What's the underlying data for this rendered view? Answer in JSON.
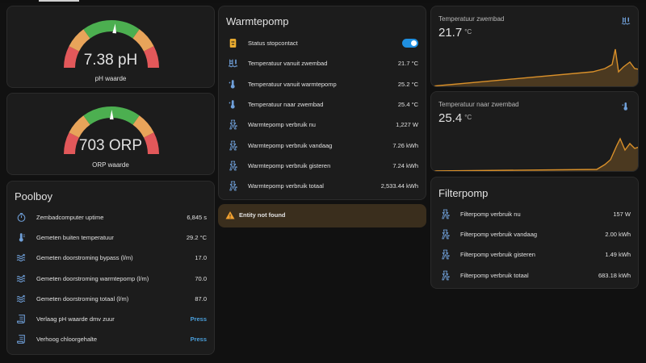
{
  "gauges": [
    {
      "value": 7.38,
      "min": 0,
      "max": 14,
      "display": "7.38 pH",
      "label": "pH waarde"
    },
    {
      "value": 703,
      "min": 0,
      "max": 1400,
      "display": "703 ORP",
      "label": "ORP waarde"
    }
  ],
  "colors": {
    "green": "#4caf50",
    "amber": "#e8a45a",
    "red": "#e2585a",
    "accent": "#1f8fe0",
    "press": "#4a9eda",
    "graph": "#d9902a"
  },
  "poolboy": {
    "title": "Poolboy",
    "rows": [
      {
        "icon": "timer-icon",
        "label": "Zembadcomputer uptime",
        "value": "6,845 s"
      },
      {
        "icon": "thermometer-icon",
        "label": "Gemeten buiten temperatuur",
        "value": "29.2 °C"
      },
      {
        "icon": "water-flow-icon",
        "label": "Gemeten doorstroming bypass (l/m)",
        "value": "17.0"
      },
      {
        "icon": "water-flow-icon",
        "label": "Gemeten doorstroming warmtepomp (l/m)",
        "value": "70.0"
      },
      {
        "icon": "water-flow-icon",
        "label": "Gemeten doorstroming totaal (l/m)",
        "value": "87.0"
      },
      {
        "icon": "script-icon",
        "label": "Verlaag pH waarde dmv zuur",
        "action": "Press"
      },
      {
        "icon": "script-icon",
        "label": "Verhoog chloorgehalte",
        "action": "Press"
      }
    ]
  },
  "warmtepomp": {
    "title": "Warmtepomp",
    "rows": [
      {
        "icon": "power-socket-icon",
        "label": "Status stopcontact",
        "toggle": true
      },
      {
        "icon": "pool-thermometer-icon",
        "label": "Temperatuur vanuit zwembad",
        "value": "21.7 °C"
      },
      {
        "icon": "thermometer-water-icon",
        "label": "Temperatuur vanuit warmtepomp",
        "value": "25.2 °C"
      },
      {
        "icon": "thermometer-water-icon",
        "label": "Temperatuur naar zwembad",
        "value": "25.4 °C"
      },
      {
        "icon": "transmission-tower-icon",
        "label": "Warmtepomp verbruik nu",
        "value": "1,227 W"
      },
      {
        "icon": "transmission-tower-icon",
        "label": "Warmtepomp verbruik vandaag",
        "value": "7.26 kWh"
      },
      {
        "icon": "transmission-tower-icon",
        "label": "Warmtepomp verbruik gisteren",
        "value": "7.24 kWh"
      },
      {
        "icon": "transmission-tower-icon",
        "label": "Warmtepomp verbruik totaal",
        "value": "2,533.44 kWh"
      }
    ]
  },
  "warning": {
    "icon": "alert-icon",
    "text": "Entity not found"
  },
  "sensors": [
    {
      "name": "Temperatuur zwembad",
      "value": "21.7",
      "unit": "°C",
      "icon": "pool-thermometer-icon"
    },
    {
      "name": "Temperatuur naar zwembad",
      "value": "25.4",
      "unit": "°C",
      "icon": "thermometer-water-icon"
    }
  ],
  "filterpomp": {
    "title": "Filterpomp",
    "rows": [
      {
        "icon": "transmission-tower-icon",
        "label": "Filterpomp verbruik nu",
        "value": "157 W"
      },
      {
        "icon": "transmission-tower-icon",
        "label": "Filterpomp verbruik vandaag",
        "value": "2.00 kWh"
      },
      {
        "icon": "transmission-tower-icon",
        "label": "Filterpomp verbruik gisteren",
        "value": "1.49 kWh"
      },
      {
        "icon": "transmission-tower-icon",
        "label": "Filterpomp verbruik totaal",
        "value": "683.18 kWh"
      }
    ]
  }
}
